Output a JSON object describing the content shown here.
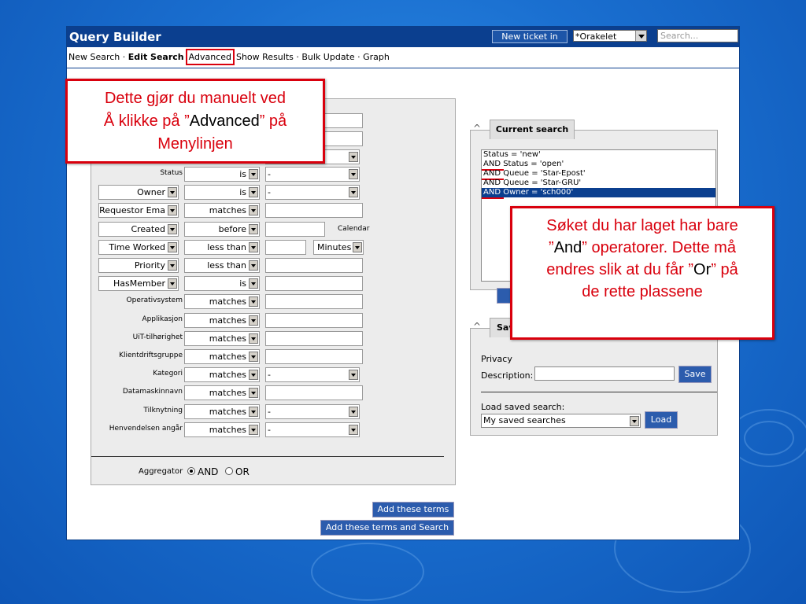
{
  "window": {
    "title": "Query Builder",
    "new_ticket_label": "New ticket in",
    "queue_value": "*Orakelet",
    "search_placeholder": "Search..."
  },
  "menu": {
    "new_search": "New Search · ",
    "edit_search": "Edit Search",
    "advanced": "Advanced",
    "show_results": "Show Results · ",
    "bulk_update": "Bulk Update · ",
    "graph": "Graph"
  },
  "criteria_rows": [
    {
      "label": "Status",
      "op": "is",
      "value": "-"
    },
    {
      "field": "Owner",
      "op": "is",
      "value": "-"
    },
    {
      "field": "Requestor Ema",
      "op": "matches",
      "value": ""
    },
    {
      "field": "Created",
      "op": "before",
      "value": "",
      "extra": "Calendar"
    },
    {
      "field": "Time Worked",
      "op": "less than",
      "value": "",
      "unit": "Minutes"
    },
    {
      "field": "Priority",
      "op": "less than",
      "value": ""
    },
    {
      "field": "HasMember",
      "op": "is",
      "value": ""
    },
    {
      "label": "Operativsystem",
      "op": "matches",
      "value": ""
    },
    {
      "label": "Applikasjon",
      "op": "matches",
      "value": ""
    },
    {
      "label": "UiT-tilhørighet",
      "op": "matches",
      "value": ""
    },
    {
      "label": "Klientdriftsgruppe",
      "op": "matches",
      "value": ""
    },
    {
      "label": "Kategori",
      "op": "matches",
      "value": "-"
    },
    {
      "label": "Datamaskinnavn",
      "op": "matches",
      "value": ""
    },
    {
      "label": "Tilknytning",
      "op": "matches",
      "value": "-"
    },
    {
      "label": "Henvendelsen angår",
      "op": "matches",
      "value": "-"
    }
  ],
  "aggregator": {
    "label": "Aggregator",
    "and": "AND",
    "or": "OR"
  },
  "buttons": {
    "add_terms": "Add these terms",
    "add_terms_search": "Add these terms and Search"
  },
  "current_search": {
    "tab": "Current search",
    "items": [
      "Status = 'new'",
      "AND Status = 'open'",
      "AND Queue = 'Star-Epost'",
      "AND Queue = 'Star-GRU'",
      "AND Owner = 'sch000'"
    ]
  },
  "saved": {
    "tab": "Sav",
    "privacy": "Privacy",
    "description": "Description:",
    "save": "Save",
    "load_label": "Load saved search:",
    "load_value": "My saved searches",
    "load": "Load"
  },
  "callouts": {
    "left_1": "Dette gjør du manuelt ved",
    "left_2": "Å klikke på ”",
    "left_3": "Advanced",
    "left_4": "” på",
    "left_5": "Menylinjen",
    "right_1": "Søket du har laget har bare",
    "right_2": "”",
    "right_3": "And",
    "right_4": "” operatorer. Dette må",
    "right_5": "endres slik at du får ”",
    "right_6": "Or",
    "right_7": "” på",
    "right_8": "de rette plassene"
  }
}
